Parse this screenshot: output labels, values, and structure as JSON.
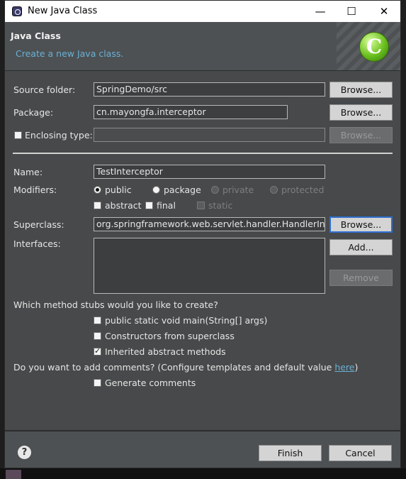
{
  "window": {
    "title": "New Java Class",
    "minimize": "—",
    "maximize": "☐",
    "close": "✕"
  },
  "header": {
    "title": "Java Class",
    "subtitle": "Create a new Java class.",
    "logo_letter": "C"
  },
  "form": {
    "source_folder": {
      "label": "Source folder:",
      "value": "SpringDemo/src",
      "button": "Browse..."
    },
    "package": {
      "label": "Package:",
      "value": "cn.mayongfa.interceptor",
      "button": "Browse..."
    },
    "enclosing_type": {
      "label": "Enclosing type:",
      "value": "",
      "checked": false,
      "button": "Browse..."
    },
    "name": {
      "label": "Name:",
      "value": "TestInterceptor"
    },
    "modifiers": {
      "label": "Modifiers:",
      "public": "public",
      "package": "package",
      "private": "private",
      "protected": "protected",
      "selected": "public",
      "abstract": "abstract",
      "final": "final",
      "static": "static"
    },
    "superclass": {
      "label": "Superclass:",
      "value": "org.springframework.web.servlet.handler.HandlerInterc",
      "button": "Browse..."
    },
    "interfaces": {
      "label": "Interfaces:",
      "add_button": "Add...",
      "remove_button": "Remove"
    },
    "stubs": {
      "question": "Which method stubs would you like to create?",
      "main": {
        "label": "public static void main(String[] args)",
        "checked": false
      },
      "constructors": {
        "label": "Constructors from superclass",
        "checked": false
      },
      "inherited": {
        "label": "Inherited abstract methods",
        "checked": true
      }
    },
    "comments": {
      "question_prefix": "Do you want to add comments? (Configure templates and default value ",
      "link": "here",
      "question_suffix": ")",
      "generate": {
        "label": "Generate comments",
        "checked": false
      }
    }
  },
  "footer": {
    "help": "?",
    "finish": "Finish",
    "cancel": "Cancel"
  }
}
